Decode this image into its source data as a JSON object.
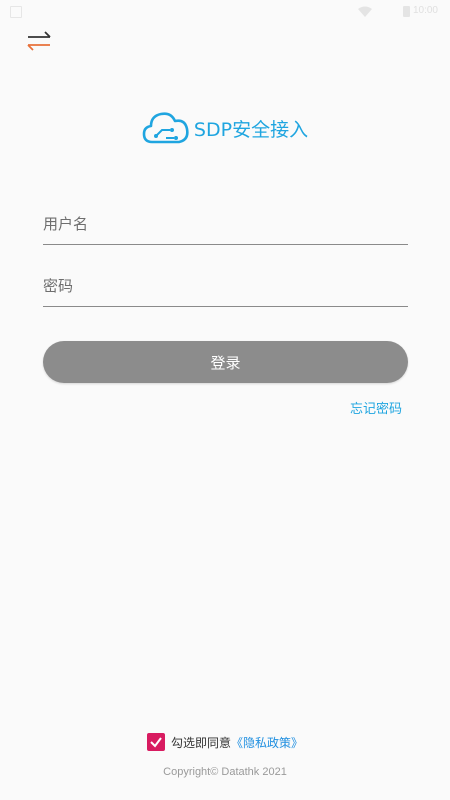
{
  "status_bar": {
    "time": "10:00",
    "icons": [
      "notification-icon",
      "wifi-icon",
      "battery-icon"
    ]
  },
  "header": {
    "switch_icon": "swap-arrows-icon"
  },
  "logo": {
    "icon": "cloud-icon",
    "title": "SDP安全接入"
  },
  "form": {
    "username_placeholder": "用户名",
    "password_placeholder": "密码",
    "login_label": "登录",
    "forgot_password": "忘记密码"
  },
  "agreement": {
    "checked": true,
    "text": "勾选即同意",
    "link": "《隐私政策》"
  },
  "footer": {
    "copyright": "Copyright© Datathk 2021"
  },
  "colors": {
    "accent": "#1fa5e0",
    "button": "#8c8c8c",
    "checkbox": "#d81b60",
    "swap_top_arrow": "#e8703a",
    "swap_bottom_arrow": "#333333"
  }
}
